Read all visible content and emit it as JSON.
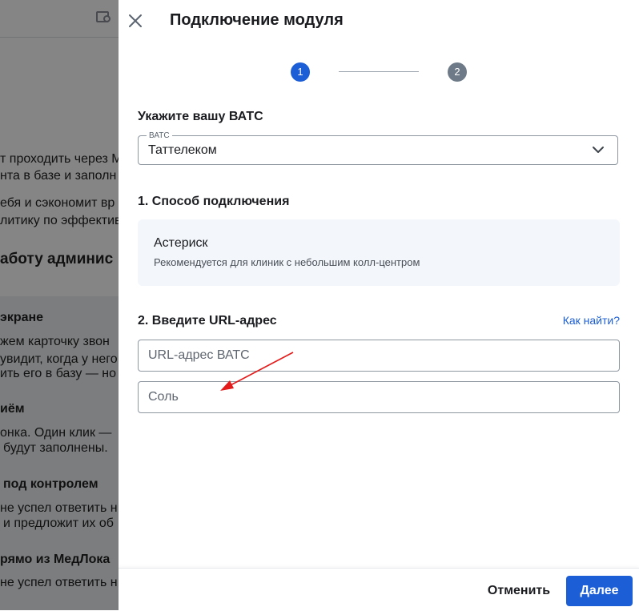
{
  "background_page": {
    "lines": [
      "т проходить через М",
      "нта в базе и заполн",
      "ебя и сэкономит вр",
      "литику по эффектив",
      "аботу админис",
      "экране",
      "жем карточку звон",
      "увидит, когда у него",
      "ить его в базу — но",
      "иём",
      "онка. Один клик —",
      "будут заполнены.",
      "под контролем",
      "не успел ответить н",
      "и предложит их об",
      "рямо из МедЛока",
      "не успел ответить н"
    ]
  },
  "drawer": {
    "title": "Подключение модуля",
    "stepper": {
      "step1": "1",
      "step2": "2",
      "active_color": "#1c5ed6",
      "inactive_color": "#6e7a87"
    },
    "pbx_section": {
      "title": "Укажите вашу ВАТС",
      "select_label": "ВАТС",
      "select_value": "Таттелеком"
    },
    "connection_section": {
      "title": "1. Способ подключения",
      "option_title": "Астериск",
      "option_description": "Рекомендуется для клиник с небольшим колл-центром"
    },
    "url_section": {
      "title": "2. Введите URL-адрес",
      "help_link": "Как найти?",
      "url_placeholder": "URL-адрес ВАТС",
      "salt_placeholder": "Соль"
    },
    "footer": {
      "cancel_label": "Отменить",
      "next_label": "Далее"
    }
  },
  "colors": {
    "accent": "#1c5ed6",
    "annotation_arrow": "#e31b1b"
  }
}
